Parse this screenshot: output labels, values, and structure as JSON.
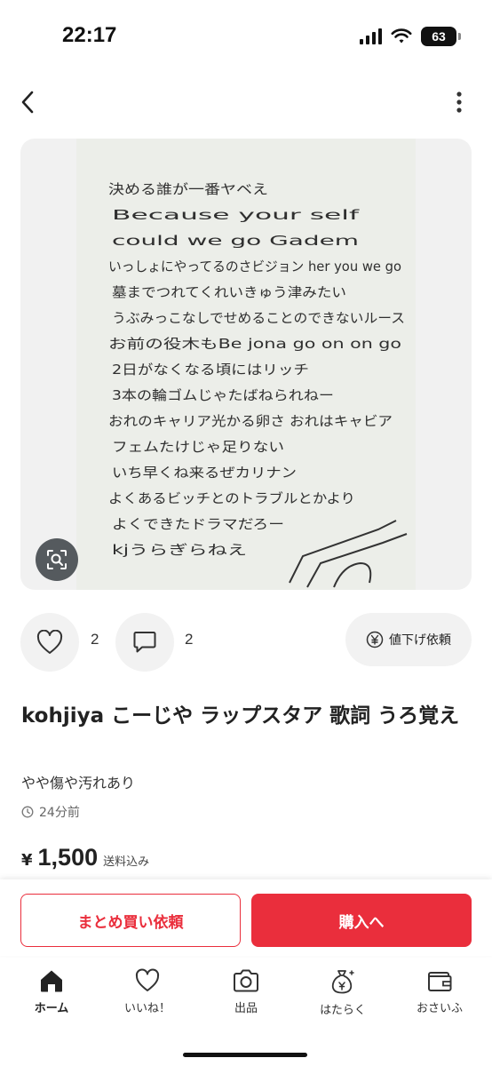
{
  "status_bar": {
    "time": "22:17",
    "battery": "63"
  },
  "header": {
    "back_icon": "chevron-left-icon",
    "menu_icon": "more-vertical-icon"
  },
  "photo": {
    "description_icon": "image-search-icon",
    "handwritten_lines": [
      "決める誰が一番ヤベえ",
      "Because your self",
      "could we go Gadem",
      "いっしょにやってるのさビジョン her you we go",
      "墓までつれてくれいきゅう津みたい",
      "うぶみっこなしでせめることのできないルース",
      "お前の役木もBe jona go on on go",
      "2日がなくなる頃にはリッチ",
      "3本の輪ゴムじゃたばねられねー",
      "おれのキャリア光かる卵さ おれはキャビア",
      "フェムたけじゃ足りない",
      "いち早くね来るぜカリナン",
      "よくあるビッチとのトラブルとかより",
      "よくできたドラマだろー",
      "kjうらぎらねえ"
    ]
  },
  "actions": {
    "like_count": "2",
    "comment_count": "2",
    "price_down_label": "値下げ依頼"
  },
  "item": {
    "title": "kohjiya こーじや ラップスタア 歌詞 うろ覚え",
    "condition": "やや傷や汚れあり",
    "posted": "24分前",
    "price_symbol": "¥",
    "price": "1,500",
    "shipping": "送料込み"
  },
  "cta": {
    "bulk_label": "まとめ買い依頼",
    "buy_label": "購入へ"
  },
  "tabs": [
    {
      "label": "ホーム",
      "icon": "home-icon"
    },
    {
      "label": "いいね！",
      "icon": "heart-icon"
    },
    {
      "label": "出品",
      "icon": "camera-icon"
    },
    {
      "label": "はたらく",
      "icon": "money-bag-icon"
    },
    {
      "label": "おさいふ",
      "icon": "wallet-icon"
    }
  ],
  "colors": {
    "accent": "#ea2e3c"
  }
}
